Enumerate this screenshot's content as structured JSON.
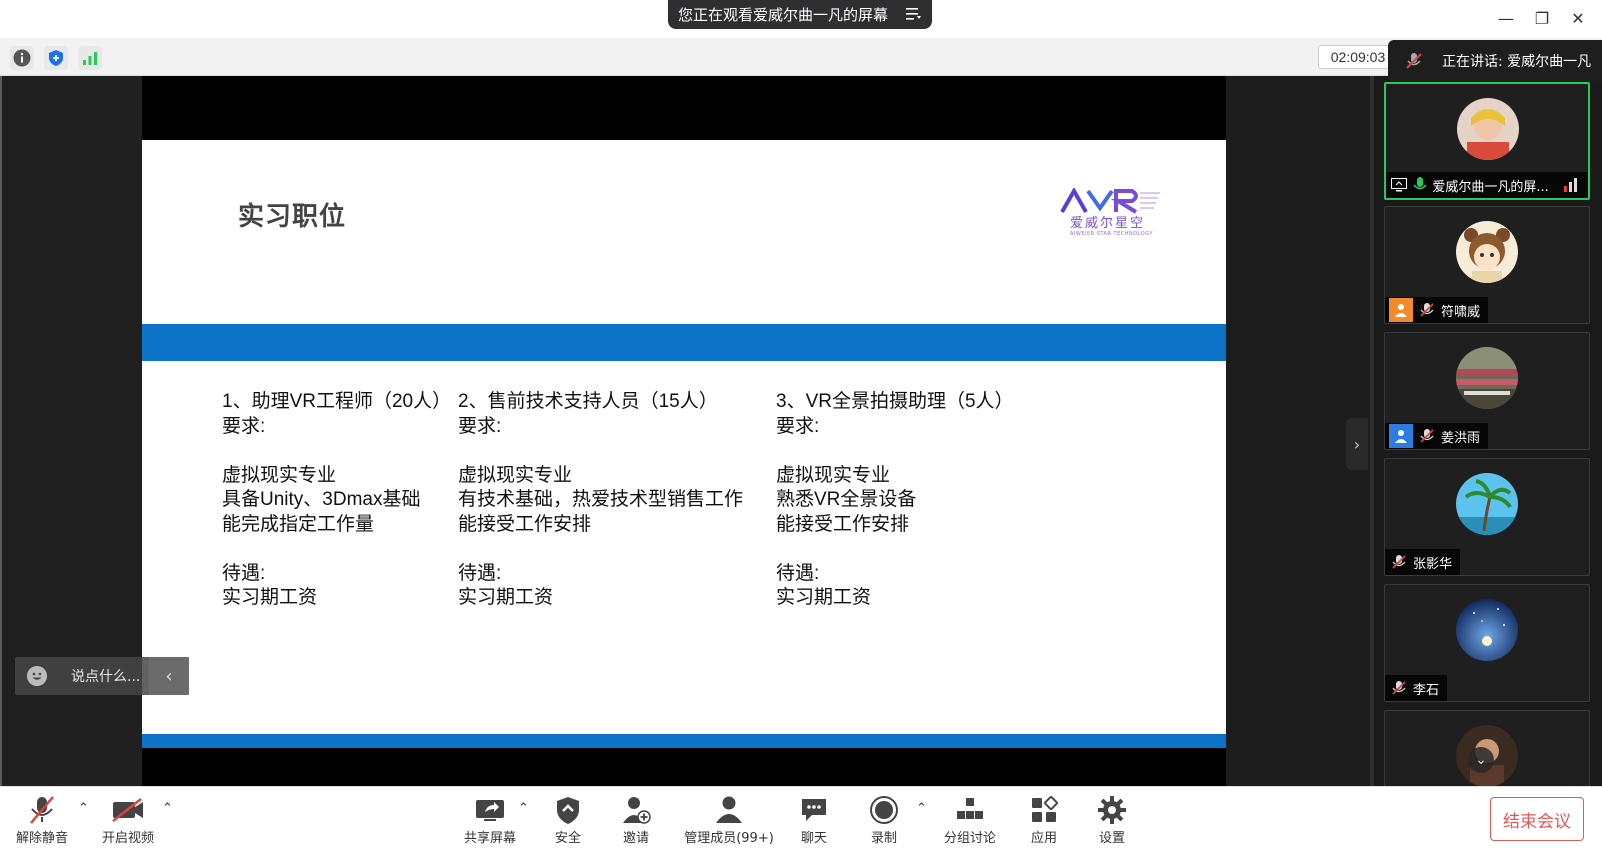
{
  "window": {
    "sharing_banner": "您正在观看爱威尔曲一凡的屏幕",
    "minimize": "—",
    "restore": "❐",
    "close": "✕"
  },
  "infobar": {
    "timer": "02:09:03",
    "speaking_label": "正在讲话: 爱威尔曲一凡"
  },
  "slide": {
    "title": "实习职位",
    "logo_text": "爱威尔星空",
    "logo_sub": "AIWEIER STAR TECHNOLOGY",
    "columns": [
      {
        "heading": "1、助理VR工程师（20人）",
        "req_label": "要求:",
        "reqs": [
          "虚拟现实专业",
          "具备Unity、3Dmax基础",
          "能完成指定工作量"
        ],
        "benefit_label": "待遇:",
        "benefit": "实习期工资"
      },
      {
        "heading": "2、售前技术支持人员（15人）",
        "req_label": "要求:",
        "reqs": [
          "虚拟现实专业",
          "有技术基础，热爱技术型销售工作",
          "能接受工作安排"
        ],
        "benefit_label": "待遇:",
        "benefit": "实习期工资"
      },
      {
        "heading": "3、VR全景拍摄助理（5人）",
        "req_label": "要求:",
        "reqs": [
          "虚拟现实专业",
          "熟悉VR全景设备",
          "能接受工作安排"
        ],
        "benefit_label": "待遇:",
        "benefit": "实习期工资"
      }
    ]
  },
  "chat": {
    "placeholder": "说点什么..."
  },
  "participants": [
    {
      "name": "爱威尔曲一凡的屏...",
      "active": true,
      "avatar_color": "#d9b7a6"
    },
    {
      "name": "符啸威",
      "active": false,
      "avatar_color": "#f3e3c4"
    },
    {
      "name": "姜洪雨",
      "active": false,
      "avatar_color": "#6d6a55"
    },
    {
      "name": "张影华",
      "active": false,
      "avatar_color": "#3fa6d8"
    },
    {
      "name": "李石",
      "active": false,
      "avatar_color": "#1f3f8c"
    },
    {
      "name": "",
      "active": false,
      "avatar_color": "#5b3a2a"
    }
  ],
  "toolbar": {
    "unmute": "解除静音",
    "start_video": "开启视频",
    "share_screen": "共享屏幕",
    "security": "安全",
    "invite": "邀请",
    "manage_members": "管理成员(99+)",
    "chat": "聊天",
    "record": "录制",
    "breakout": "分组讨论",
    "apps": "应用",
    "settings": "设置",
    "end_meeting": "结束会议"
  },
  "colors": {
    "slide_blue": "#0c73c9",
    "active_green": "#2ec85a",
    "end_red": "#e05a5a"
  }
}
